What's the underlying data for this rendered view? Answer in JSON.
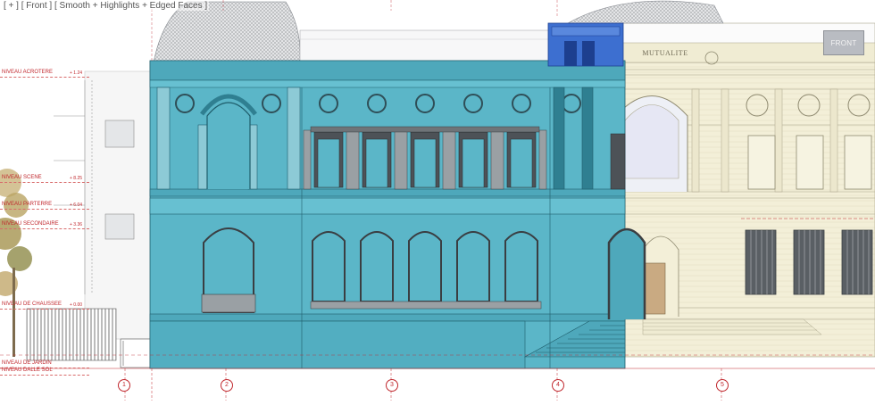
{
  "viewport": {
    "label": "[ + ] [ Front ] [ Smooth + Highlights + Edged Faces ]",
    "gizmo_label": "FRONT"
  },
  "building": {
    "inscription": "MUTUALITE"
  },
  "levels": [
    {
      "label": "NIVEAU ACROTERE",
      "elev": "+ 1.24"
    },
    {
      "label": "NIVEAU SCENE",
      "elev": "+ 8.25"
    },
    {
      "label": "NIVEAU PARTERRE",
      "elev": "+ 6.04"
    },
    {
      "label": "NIVEAU SECONDAIRE",
      "elev": "+ 3.36"
    },
    {
      "label": "NIVEAU DE CHAUSSEE",
      "elev": "+ 0.00"
    },
    {
      "label": "NIVEAU DE JARDIN",
      "elev": ""
    },
    {
      "label": "NIVEAU DALLE SOL",
      "elev": ""
    }
  ],
  "grid_axes": [
    "1",
    "2",
    "3",
    "4",
    "5"
  ],
  "colors": {
    "selection": "#5bb6c8",
    "selection_dark": "#2f7f91",
    "selection_line": "#1e5c6a",
    "tower": "#3d6fd0",
    "tower_dark": "#1d3f8f",
    "stone": "#f3efd8",
    "stone_line": "#a9a48a",
    "roof": "#d7d8da",
    "window_dark": "#4d5257",
    "window_grey": "#9aa0a4",
    "red": "#c0272d"
  }
}
